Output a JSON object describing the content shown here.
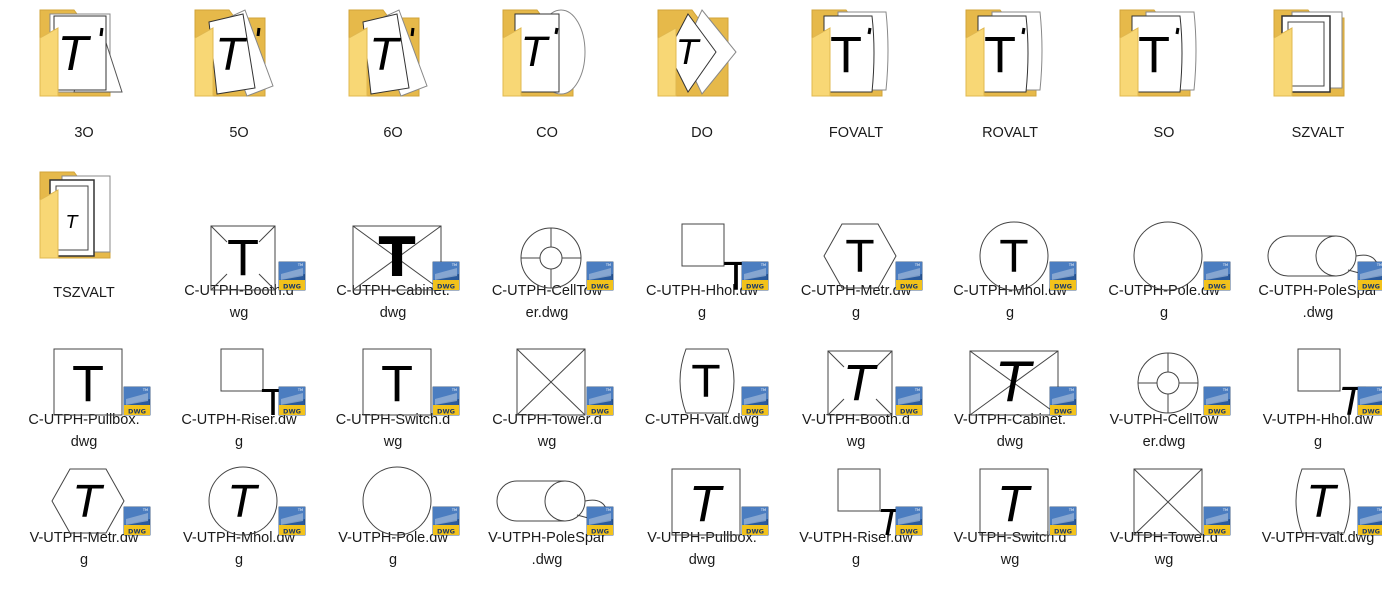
{
  "folders": [
    {
      "name": "3O",
      "shape": "tri"
    },
    {
      "name": "5O",
      "shape": "tilt"
    },
    {
      "name": "6O",
      "shape": "tilt"
    },
    {
      "name": "CO",
      "shape": "circle"
    },
    {
      "name": "DO",
      "shape": "diamond"
    },
    {
      "name": "FOVALT",
      "shape": "valt"
    },
    {
      "name": "ROVALT",
      "shape": "valt"
    },
    {
      "name": "SO",
      "shape": "valt"
    },
    {
      "name": "SZVALT",
      "shape": "frame"
    },
    {
      "name": "TSZVALT",
      "shape": "frame2"
    }
  ],
  "files": [
    {
      "name": "C-UTPH-Booth.dwg",
      "line1": "C-UTPH-Booth.d",
      "line2": "wg",
      "icon": "booth",
      "italic": false
    },
    {
      "name": "C-UTPH-Cabinet.dwg",
      "line1": "C-UTPH-Cabinet.",
      "line2": "dwg",
      "icon": "cabinet",
      "italic": false
    },
    {
      "name": "C-UTPH-CellTower.dwg",
      "line1": "C-UTPH-CellTow",
      "line2": "er.dwg",
      "icon": "celltower",
      "italic": false
    },
    {
      "name": "C-UTPH-Hhol.dwg",
      "line1": "C-UTPH-Hhol.dw",
      "line2": "g",
      "icon": "hhol",
      "italic": false
    },
    {
      "name": "C-UTPH-Metr.dwg",
      "line1": "C-UTPH-Metr.dw",
      "line2": "g",
      "icon": "metr",
      "italic": false
    },
    {
      "name": "C-UTPH-Mhol.dwg",
      "line1": "C-UTPH-Mhol.dw",
      "line2": "g",
      "icon": "mhol",
      "italic": false
    },
    {
      "name": "C-UTPH-Pole.dwg",
      "line1": "C-UTPH-Pole.dw",
      "line2": "g",
      "icon": "pole",
      "italic": false
    },
    {
      "name": "C-UTPH-PoleSpar.dwg",
      "line1": "C-UTPH-PoleSpar",
      "line2": ".dwg",
      "icon": "polespar",
      "italic": false
    },
    {
      "name": "C-UTPH-Pullbox.dwg",
      "line1": "C-UTPH-Pullbox.",
      "line2": "dwg",
      "icon": "pullbox",
      "italic": false
    },
    {
      "name": "C-UTPH-Riser.dwg",
      "line1": "C-UTPH-Riser.dw",
      "line2": "g",
      "icon": "riser",
      "italic": false
    },
    {
      "name": "C-UTPH-Switch.dwg",
      "line1": "C-UTPH-Switch.d",
      "line2": "wg",
      "icon": "switch",
      "italic": false
    },
    {
      "name": "C-UTPH-Tower.dwg",
      "line1": "C-UTPH-Tower.d",
      "line2": "wg",
      "icon": "tower",
      "italic": false
    },
    {
      "name": "C-UTPH-Valt.dwg",
      "line1": "C-UTPH-Valt.dwg",
      "line2": "",
      "icon": "valt",
      "italic": false
    },
    {
      "name": "V-UTPH-Booth.dwg",
      "line1": "V-UTPH-Booth.d",
      "line2": "wg",
      "icon": "booth",
      "italic": true
    },
    {
      "name": "V-UTPH-Cabinet.dwg",
      "line1": "V-UTPH-Cabinet.",
      "line2": "dwg",
      "icon": "cabinet",
      "italic": true
    },
    {
      "name": "V-UTPH-CellTower.dwg",
      "line1": "V-UTPH-CellTow",
      "line2": "er.dwg",
      "icon": "celltower",
      "italic": true
    },
    {
      "name": "V-UTPH-Hhol.dwg",
      "line1": "V-UTPH-Hhol.dw",
      "line2": "g",
      "icon": "hhol",
      "italic": true
    },
    {
      "name": "V-UTPH-Metr.dwg",
      "line1": "V-UTPH-Metr.dw",
      "line2": "g",
      "icon": "metr",
      "italic": true
    },
    {
      "name": "V-UTPH-Mhol.dwg",
      "line1": "V-UTPH-Mhol.dw",
      "line2": "g",
      "icon": "mhol",
      "italic": true
    },
    {
      "name": "V-UTPH-Pole.dwg",
      "line1": "V-UTPH-Pole.dw",
      "line2": "g",
      "icon": "pole",
      "italic": true
    },
    {
      "name": "V-UTPH-PoleSpar.dwg",
      "line1": "V-UTPH-PoleSpar",
      "line2": ".dwg",
      "icon": "polespar",
      "italic": true
    },
    {
      "name": "V-UTPH-Pullbox.dwg",
      "line1": "V-UTPH-Pullbox.",
      "line2": "dwg",
      "icon": "pullbox",
      "italic": true
    },
    {
      "name": "V-UTPH-Riser.dwg",
      "line1": "V-UTPH-Riser.dw",
      "line2": "g",
      "icon": "riser",
      "italic": true
    },
    {
      "name": "V-UTPH-Switch.dwg",
      "line1": "V-UTPH-Switch.d",
      "line2": "wg",
      "icon": "switch",
      "italic": true
    },
    {
      "name": "V-UTPH-Tower.dwg",
      "line1": "V-UTPH-Tower.d",
      "line2": "wg",
      "icon": "tower",
      "italic": true
    },
    {
      "name": "V-UTPH-Valt.dwg",
      "line1": "V-UTPH-Valt.dwg",
      "line2": "",
      "icon": "valt",
      "italic": true
    }
  ],
  "badge_text": "DWG",
  "badge_tm": "TM",
  "colors": {
    "folder_back": "#e6b94a",
    "folder_front": "#f8d775",
    "badge_blue": "#1f4e8c",
    "badge_yellow": "#f2c21b",
    "label": "#1a1a1a"
  }
}
